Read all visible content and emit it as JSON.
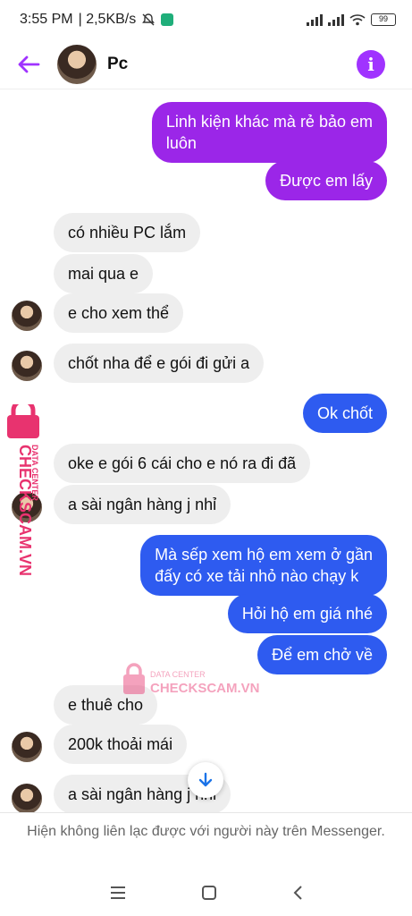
{
  "status_bar": {
    "time": "3:55 PM",
    "speed": "| 2,5KB/s",
    "battery": "99"
  },
  "header": {
    "contact_name": "Pc",
    "info_label": "i"
  },
  "messages": [
    {
      "side": "out",
      "color": "purple",
      "text_lines": [
        "Linh kiện khác mà rẻ bảo em",
        "luôn"
      ]
    },
    {
      "side": "out",
      "color": "purple",
      "text_lines": [
        "Được em lấy"
      ]
    },
    {
      "side": "in",
      "text_lines": [
        "có nhiều PC lắm"
      ]
    },
    {
      "side": "in",
      "text_lines": [
        "mai qua e"
      ]
    },
    {
      "side": "in",
      "text_lines": [
        "e cho xem thể"
      ]
    },
    {
      "side": "in",
      "text_lines": [
        "chốt nha để e gói đi gửi a"
      ]
    },
    {
      "side": "out",
      "color": "blue",
      "text_lines": [
        "Ok chốt"
      ]
    },
    {
      "side": "in",
      "text_lines": [
        "oke e gói 6 cái cho e nó ra đi đã"
      ]
    },
    {
      "side": "in",
      "text_lines": [
        "a sài ngân hàng j nhỉ"
      ]
    },
    {
      "side": "out",
      "color": "blue",
      "text_lines": [
        "Mà sếp xem hộ em xem ở gần",
        "đấy có xe tải nhỏ nào chạy k"
      ]
    },
    {
      "side": "out",
      "color": "blue",
      "text_lines": [
        "Hỏi hộ em giá nhé"
      ]
    },
    {
      "side": "out",
      "color": "blue",
      "text_lines": [
        "Để em chở về"
      ]
    },
    {
      "side": "in",
      "text_lines": [
        "e thuê cho"
      ]
    },
    {
      "side": "in",
      "text_lines": [
        "200k thoải mái"
      ]
    },
    {
      "side": "in",
      "text_lines": [
        "a sài ngân hàng j nhỉ"
      ]
    }
  ],
  "watermark": {
    "side_line1": "DATA CENTER",
    "side_line2": "CHECKSCAM.VN",
    "center_line1": "DATA CENTER",
    "center_line2": "CHECKSCAM.VN"
  },
  "footer": {
    "notice": "Hiện không liên lạc được với người này trên Messenger."
  },
  "icons": {
    "back": "arrow-left",
    "info": "info-circle",
    "scroll_down": "arrow-down",
    "nav_menu": "hamburger",
    "nav_home": "square",
    "nav_back": "chevron-left"
  },
  "colors": {
    "accent_purple": "#9b26e8",
    "accent_blue": "#2e5bf0",
    "incoming_bg": "#eeeeee"
  }
}
